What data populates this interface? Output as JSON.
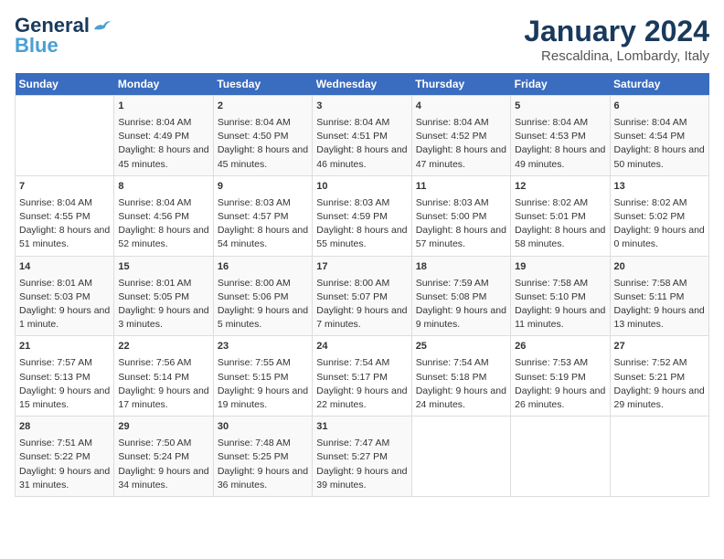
{
  "header": {
    "logo_line1": "General",
    "logo_line2": "Blue",
    "main_title": "January 2024",
    "subtitle": "Rescaldina, Lombardy, Italy"
  },
  "days_of_week": [
    "Sunday",
    "Monday",
    "Tuesday",
    "Wednesday",
    "Thursday",
    "Friday",
    "Saturday"
  ],
  "weeks": [
    [
      {
        "day": "",
        "sunrise": "",
        "sunset": "",
        "daylight": ""
      },
      {
        "day": "1",
        "sunrise": "Sunrise: 8:04 AM",
        "sunset": "Sunset: 4:49 PM",
        "daylight": "Daylight: 8 hours and 45 minutes."
      },
      {
        "day": "2",
        "sunrise": "Sunrise: 8:04 AM",
        "sunset": "Sunset: 4:50 PM",
        "daylight": "Daylight: 8 hours and 45 minutes."
      },
      {
        "day": "3",
        "sunrise": "Sunrise: 8:04 AM",
        "sunset": "Sunset: 4:51 PM",
        "daylight": "Daylight: 8 hours and 46 minutes."
      },
      {
        "day": "4",
        "sunrise": "Sunrise: 8:04 AM",
        "sunset": "Sunset: 4:52 PM",
        "daylight": "Daylight: 8 hours and 47 minutes."
      },
      {
        "day": "5",
        "sunrise": "Sunrise: 8:04 AM",
        "sunset": "Sunset: 4:53 PM",
        "daylight": "Daylight: 8 hours and 49 minutes."
      },
      {
        "day": "6",
        "sunrise": "Sunrise: 8:04 AM",
        "sunset": "Sunset: 4:54 PM",
        "daylight": "Daylight: 8 hours and 50 minutes."
      }
    ],
    [
      {
        "day": "7",
        "sunrise": "Sunrise: 8:04 AM",
        "sunset": "Sunset: 4:55 PM",
        "daylight": "Daylight: 8 hours and 51 minutes."
      },
      {
        "day": "8",
        "sunrise": "Sunrise: 8:04 AM",
        "sunset": "Sunset: 4:56 PM",
        "daylight": "Daylight: 8 hours and 52 minutes."
      },
      {
        "day": "9",
        "sunrise": "Sunrise: 8:03 AM",
        "sunset": "Sunset: 4:57 PM",
        "daylight": "Daylight: 8 hours and 54 minutes."
      },
      {
        "day": "10",
        "sunrise": "Sunrise: 8:03 AM",
        "sunset": "Sunset: 4:59 PM",
        "daylight": "Daylight: 8 hours and 55 minutes."
      },
      {
        "day": "11",
        "sunrise": "Sunrise: 8:03 AM",
        "sunset": "Sunset: 5:00 PM",
        "daylight": "Daylight: 8 hours and 57 minutes."
      },
      {
        "day": "12",
        "sunrise": "Sunrise: 8:02 AM",
        "sunset": "Sunset: 5:01 PM",
        "daylight": "Daylight: 8 hours and 58 minutes."
      },
      {
        "day": "13",
        "sunrise": "Sunrise: 8:02 AM",
        "sunset": "Sunset: 5:02 PM",
        "daylight": "Daylight: 9 hours and 0 minutes."
      }
    ],
    [
      {
        "day": "14",
        "sunrise": "Sunrise: 8:01 AM",
        "sunset": "Sunset: 5:03 PM",
        "daylight": "Daylight: 9 hours and 1 minute."
      },
      {
        "day": "15",
        "sunrise": "Sunrise: 8:01 AM",
        "sunset": "Sunset: 5:05 PM",
        "daylight": "Daylight: 9 hours and 3 minutes."
      },
      {
        "day": "16",
        "sunrise": "Sunrise: 8:00 AM",
        "sunset": "Sunset: 5:06 PM",
        "daylight": "Daylight: 9 hours and 5 minutes."
      },
      {
        "day": "17",
        "sunrise": "Sunrise: 8:00 AM",
        "sunset": "Sunset: 5:07 PM",
        "daylight": "Daylight: 9 hours and 7 minutes."
      },
      {
        "day": "18",
        "sunrise": "Sunrise: 7:59 AM",
        "sunset": "Sunset: 5:08 PM",
        "daylight": "Daylight: 9 hours and 9 minutes."
      },
      {
        "day": "19",
        "sunrise": "Sunrise: 7:58 AM",
        "sunset": "Sunset: 5:10 PM",
        "daylight": "Daylight: 9 hours and 11 minutes."
      },
      {
        "day": "20",
        "sunrise": "Sunrise: 7:58 AM",
        "sunset": "Sunset: 5:11 PM",
        "daylight": "Daylight: 9 hours and 13 minutes."
      }
    ],
    [
      {
        "day": "21",
        "sunrise": "Sunrise: 7:57 AM",
        "sunset": "Sunset: 5:13 PM",
        "daylight": "Daylight: 9 hours and 15 minutes."
      },
      {
        "day": "22",
        "sunrise": "Sunrise: 7:56 AM",
        "sunset": "Sunset: 5:14 PM",
        "daylight": "Daylight: 9 hours and 17 minutes."
      },
      {
        "day": "23",
        "sunrise": "Sunrise: 7:55 AM",
        "sunset": "Sunset: 5:15 PM",
        "daylight": "Daylight: 9 hours and 19 minutes."
      },
      {
        "day": "24",
        "sunrise": "Sunrise: 7:54 AM",
        "sunset": "Sunset: 5:17 PM",
        "daylight": "Daylight: 9 hours and 22 minutes."
      },
      {
        "day": "25",
        "sunrise": "Sunrise: 7:54 AM",
        "sunset": "Sunset: 5:18 PM",
        "daylight": "Daylight: 9 hours and 24 minutes."
      },
      {
        "day": "26",
        "sunrise": "Sunrise: 7:53 AM",
        "sunset": "Sunset: 5:19 PM",
        "daylight": "Daylight: 9 hours and 26 minutes."
      },
      {
        "day": "27",
        "sunrise": "Sunrise: 7:52 AM",
        "sunset": "Sunset: 5:21 PM",
        "daylight": "Daylight: 9 hours and 29 minutes."
      }
    ],
    [
      {
        "day": "28",
        "sunrise": "Sunrise: 7:51 AM",
        "sunset": "Sunset: 5:22 PM",
        "daylight": "Daylight: 9 hours and 31 minutes."
      },
      {
        "day": "29",
        "sunrise": "Sunrise: 7:50 AM",
        "sunset": "Sunset: 5:24 PM",
        "daylight": "Daylight: 9 hours and 34 minutes."
      },
      {
        "day": "30",
        "sunrise": "Sunrise: 7:48 AM",
        "sunset": "Sunset: 5:25 PM",
        "daylight": "Daylight: 9 hours and 36 minutes."
      },
      {
        "day": "31",
        "sunrise": "Sunrise: 7:47 AM",
        "sunset": "Sunset: 5:27 PM",
        "daylight": "Daylight: 9 hours and 39 minutes."
      },
      {
        "day": "",
        "sunrise": "",
        "sunset": "",
        "daylight": ""
      },
      {
        "day": "",
        "sunrise": "",
        "sunset": "",
        "daylight": ""
      },
      {
        "day": "",
        "sunrise": "",
        "sunset": "",
        "daylight": ""
      }
    ]
  ]
}
